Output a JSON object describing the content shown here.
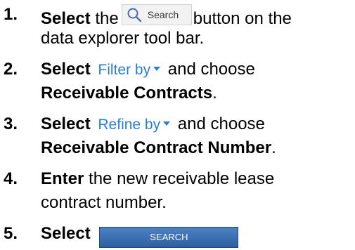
{
  "steps": [
    {
      "number": "1.",
      "verb": "Select",
      "line1_after": "button on the",
      "line2": "data explorer tool bar.",
      "search_button_label": "Search",
      "search_button_icon": "magnifier-icon"
    },
    {
      "number": "2.",
      "verb": "Select",
      "dropdown_label": "Filter by",
      "line1_after": "and choose",
      "line2_bold": "Receivable Contracts",
      "line2_end": "."
    },
    {
      "number": "3.",
      "verb": "Select",
      "dropdown_label": "Refine by",
      "line1_after": "and choose",
      "line2_bold": "Receivable Contract Number",
      "line2_end": "."
    },
    {
      "number": "4.",
      "verb": "Enter",
      "line1_after": "the new receivable lease",
      "line2": "contract number."
    },
    {
      "number": "5.",
      "verb": "Select",
      "action_button_label": "SEARCH"
    }
  ],
  "colors": {
    "dropdown_text": "#2a7fd4",
    "action_button_bg": "#3a6fb0",
    "action_button_text": "#ffffff"
  }
}
